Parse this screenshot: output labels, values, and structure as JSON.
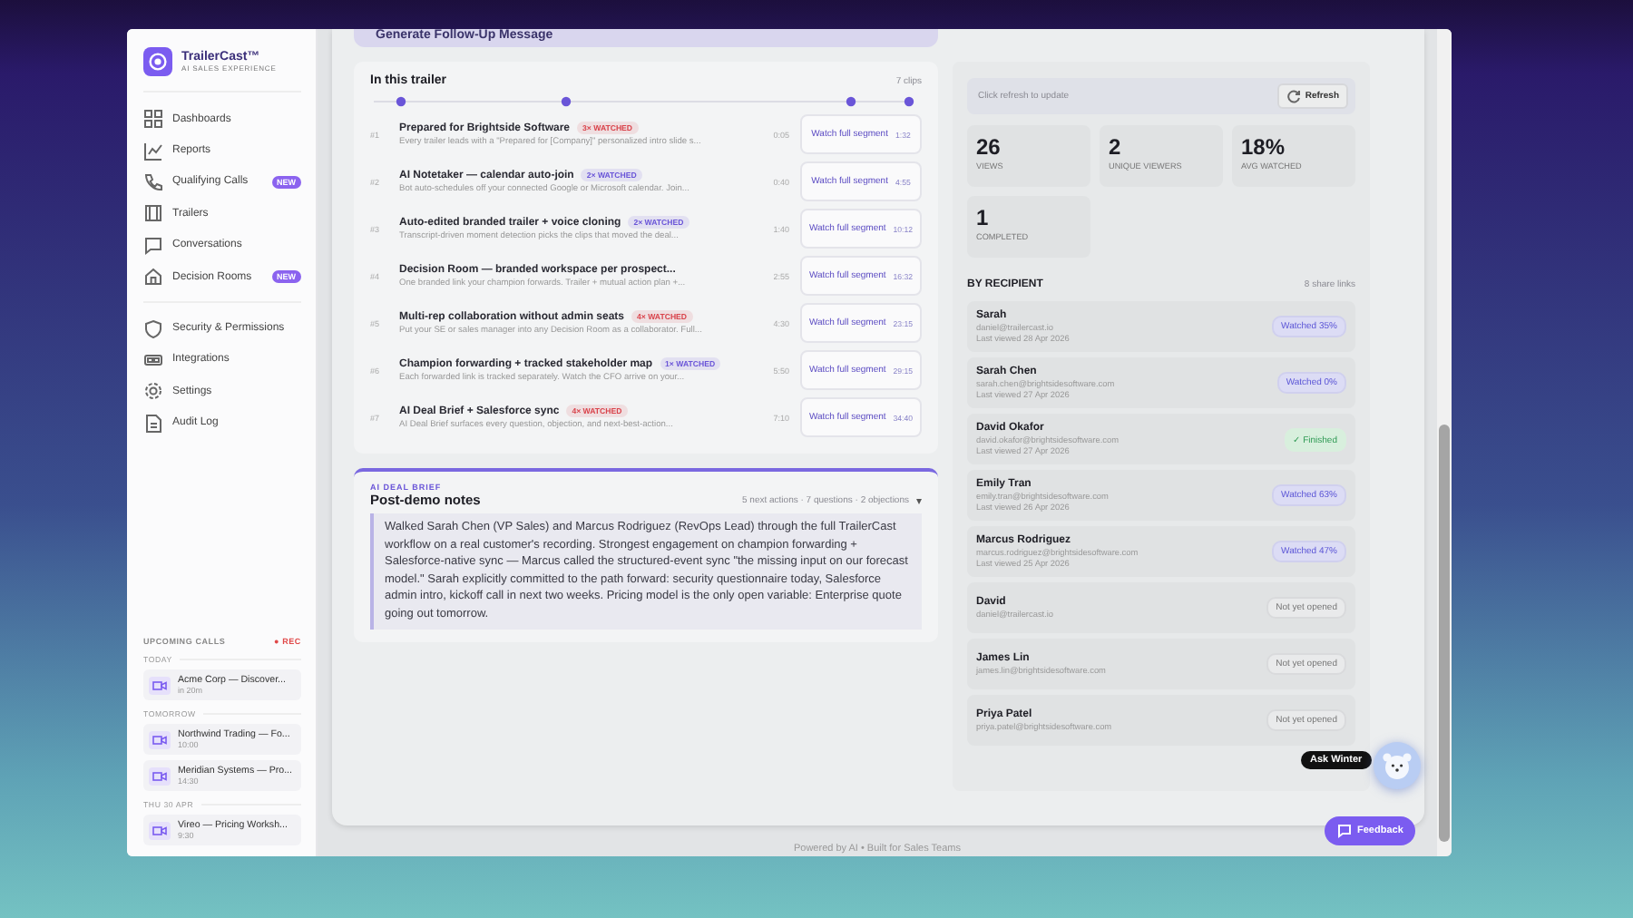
{
  "sidebar": {
    "brand": "TrailerCast™",
    "tagline": "AI SALES EXPERIENCE",
    "nav": [
      {
        "label": "Dashboards",
        "selected": false
      },
      {
        "label": "Reports",
        "selected": false
      },
      {
        "label": "Qualifying Calls",
        "badge": "NEW",
        "selected": false
      },
      {
        "label": "Trailers",
        "selected": false
      },
      {
        "label": "Conversations",
        "selected": false
      },
      {
        "label": "Decision Rooms",
        "badge": "NEW",
        "selected": false
      }
    ],
    "nav_secondary": [
      {
        "label": "Security & Permissions",
        "selected": false
      },
      {
        "label": "Integrations",
        "selected": false
      },
      {
        "label": "Settings",
        "selected": false
      },
      {
        "label": "Audit Log",
        "selected": false
      }
    ],
    "upcoming": {
      "title": "UPCOMING CALLS",
      "rec": "● REC",
      "groups": [
        {
          "label": "TODAY",
          "calls": [
            {
              "title": "Acme Corp — Discover...",
              "time": "in 20m"
            }
          ]
        },
        {
          "label": "TOMORROW",
          "calls": [
            {
              "title": "Northwind Trading — Fo...",
              "time": "10:00"
            },
            {
              "title": "Meridian Systems — Pro...",
              "time": "14:30"
            }
          ]
        },
        {
          "label": "THU 30 APR",
          "calls": [
            {
              "title": "Vireo — Pricing Worksh...",
              "time": "9:30"
            }
          ]
        }
      ]
    }
  },
  "top_action": {
    "label": "Generate Follow-Up Message"
  },
  "trailer": {
    "title": "In this trailer",
    "count": "7 clips",
    "segments": [
      {
        "number": "#1",
        "title": "Prepared for Brightside Software",
        "badge": "3× WATCHED",
        "color": "#d9434b",
        "description": "Every trailer leads with a \"Prepared for [Company]\" personalized intro slide s...",
        "start": "0:05",
        "button": "Watch full segment",
        "end": "1:32"
      },
      {
        "number": "#2",
        "title": "AI Notetaker — calendar auto-join",
        "badge": "2× WATCHED",
        "color": "#6a55d8",
        "description": "Bot auto-schedules off your connected Google or Microsoft calendar. Join...",
        "start": "0:40",
        "button": "Watch full segment",
        "end": "4:55"
      },
      {
        "number": "#3",
        "title": "Auto-edited branded trailer + voice cloning",
        "badge": "2× WATCHED",
        "color": "#6a55d8",
        "description": "Transcript-driven moment detection picks the clips that moved the deal...",
        "start": "1:40",
        "button": "Watch full segment",
        "end": "10:12"
      },
      {
        "number": "#4",
        "title": "Decision Room — branded workspace per prospect...",
        "description": "One branded link your champion forwards. Trailer + mutual action plan +...",
        "start": "2:55",
        "button": "Watch full segment",
        "end": "16:32"
      },
      {
        "number": "#5",
        "title": "Multi-rep collaboration without admin seats",
        "badge": "4× WATCHED",
        "color": "#d9434b",
        "description": "Put your SE or sales manager into any Decision Room as a collaborator. Full...",
        "start": "4:30",
        "button": "Watch full segment",
        "end": "23:15"
      },
      {
        "number": "#6",
        "title": "Champion forwarding + tracked stakeholder map",
        "badge": "1× WATCHED",
        "color": "#6a55d8",
        "description": "Each forwarded link is tracked separately. Watch the CFO arrive on your...",
        "start": "5:50",
        "button": "Watch full segment",
        "end": "29:15"
      },
      {
        "number": "#7",
        "title": "AI Deal Brief + Salesforce sync",
        "badge": "4× WATCHED",
        "color": "#d9434b",
        "description": "AI Deal Brief surfaces every question, objection, and next-best-action...",
        "start": "7:10",
        "button": "Watch full segment",
        "end": "34:40"
      }
    ]
  },
  "deal_brief": {
    "eyebrow": "AI DEAL BRIEF",
    "title": "Post-demo notes",
    "summary": "5 next actions · 7 questions · 2 objections",
    "toggle": "▾",
    "expanded": true,
    "body": "Walked Sarah Chen (VP Sales) and Marcus Rodriguez (RevOps Lead) through the full TrailerCast workflow on a real customer's recording. Strongest engagement on champion forwarding + Salesforce-native sync — Marcus called the structured-event sync \"the missing input on our forecast model.\" Sarah explicitly committed to the path forward: security questionnaire today, Salesforce admin intro, kickoff call in next two weeks. Pricing model is the only open variable: Enterprise quote going out tomorrow."
  },
  "analytics": {
    "hint": "Click refresh to update",
    "refresh": "Refresh",
    "stats": [
      {
        "value": "26",
        "label": "VIEWS"
      },
      {
        "value": "2",
        "label": "UNIQUE VIEWERS"
      },
      {
        "value": "18%",
        "label": "AVG WATCHED"
      },
      {
        "value": "1",
        "label": "COMPLETED"
      }
    ],
    "recipients_title": "BY RECIPIENT",
    "share_links": "8 share links",
    "recipients": [
      {
        "name": "Sarah",
        "email": "daniel@trailercast.io",
        "last_viewed": "Last viewed 28 Apr 2026",
        "status": "Watched 35%",
        "kind": "watched"
      },
      {
        "name": "Sarah Chen",
        "email": "sarah.chen@brightsidesoftware.com",
        "last_viewed": "Last viewed 27 Apr 2026",
        "status": "Watched 0%",
        "kind": "watched"
      },
      {
        "name": "David Okafor",
        "email": "david.okafor@brightsidesoftware.com",
        "last_viewed": "Last viewed 27 Apr 2026",
        "status": "✓ Finished",
        "kind": "finished"
      },
      {
        "name": "Emily Tran",
        "email": "emily.tran@brightsidesoftware.com",
        "last_viewed": "Last viewed 26 Apr 2026",
        "status": "Watched 63%",
        "kind": "watched"
      },
      {
        "name": "Marcus Rodriguez",
        "email": "marcus.rodriguez@brightsidesoftware.com",
        "last_viewed": "Last viewed 25 Apr 2026",
        "status": "Watched 47%",
        "kind": "watched"
      },
      {
        "name": "David",
        "email": "daniel@trailercast.io",
        "status": "Not yet opened",
        "kind": "unopened"
      },
      {
        "name": "James Lin",
        "email": "james.lin@brightsidesoftware.com",
        "status": "Not yet opened",
        "kind": "unopened"
      },
      {
        "name": "Priya Patel",
        "email": "priya.patel@brightsidesoftware.com",
        "status": "Not yet opened",
        "kind": "unopened"
      }
    ]
  },
  "assistant": {
    "label": "Ask Winter"
  },
  "feedback": {
    "label": "Feedback"
  },
  "footer": "Powered by AI • Built for Sales Teams"
}
